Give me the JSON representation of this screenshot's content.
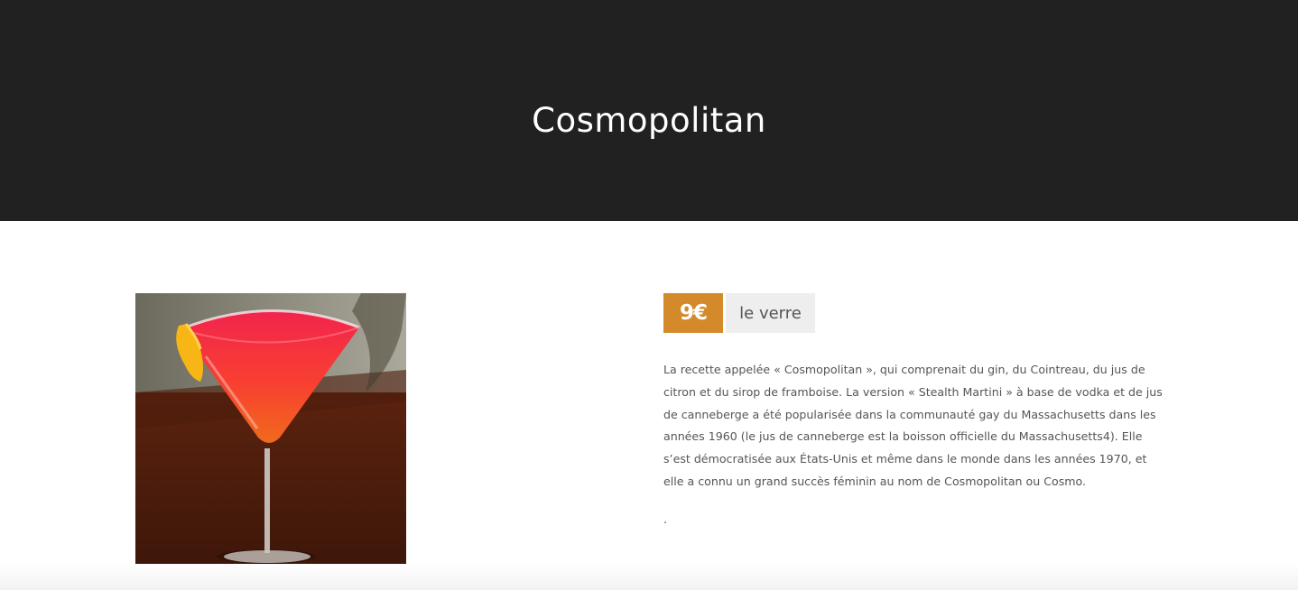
{
  "hero": {
    "title": "Cosmopolitan"
  },
  "product": {
    "image_subject": "cosmopolitan cocktail in martini glass with lemon twist",
    "price": "9€",
    "unit": "le verre",
    "description": "La recette appelée « Cosmopolitan », qui comprenait du gin, du Cointreau, du jus de citron et du sirop de framboise. La version « Stealth Martini » à base de vodka et de jus de canneberge a été popularisée dans la communauté gay du Massachusetts dans les années 1960 (le jus de canneberge est la boisson officielle du Massachusetts4). Elle s’est démocratisée aux États-Unis et même dans le monde dans les années 1970, et elle a connu un grand succès féminin au nom de Cosmopolitan ou Cosmo.",
    "trailing_text": "."
  },
  "colors": {
    "hero_bg": "#222121",
    "price_accent": "#d4892b",
    "unit_bg": "#eeeeee",
    "body_text": "#555555"
  }
}
